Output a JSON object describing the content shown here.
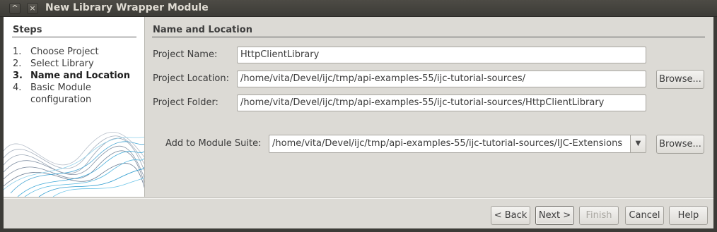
{
  "window": {
    "title": "New Library Wrapper Module",
    "min_glyph": "^",
    "close_glyph": "×"
  },
  "steps": {
    "title": "Steps",
    "items": [
      {
        "num": "1.",
        "label": "Choose Project",
        "current": false
      },
      {
        "num": "2.",
        "label": "Select Library",
        "current": false
      },
      {
        "num": "3.",
        "label": "Name and Location",
        "current": true
      },
      {
        "num": "4.",
        "label": "Basic Module configuration",
        "current": false
      }
    ]
  },
  "panel": {
    "title": "Name and Location",
    "project_name_label": "Project Name:",
    "project_name_value": "HttpClientLibrary",
    "project_location_label": "Project Location:",
    "project_location_value": "/home/vita/Devel/ijc/tmp/api-examples-55/ijc-tutorial-sources/",
    "project_folder_label": "Project Folder:",
    "project_folder_value": "/home/vita/Devel/ijc/tmp/api-examples-55/ijc-tutorial-sources/HttpClientLibrary",
    "suite_label": "Add to Module Suite:",
    "suite_value": "/home/vita/Devel/ijc/tmp/api-examples-55/ijc-tutorial-sources/IJC-Extensions",
    "browse_label": "Browse..."
  },
  "footer": {
    "back_label": "< Back",
    "next_label": "Next >",
    "finish_label": "Finish",
    "cancel_label": "Cancel",
    "help_label": "Help"
  },
  "colors": {
    "titlebar": "#3c3b37",
    "window_bg": "#dcdad5",
    "sidebar_bg": "#ffffff",
    "wave_accent": "#3fa9d8"
  }
}
